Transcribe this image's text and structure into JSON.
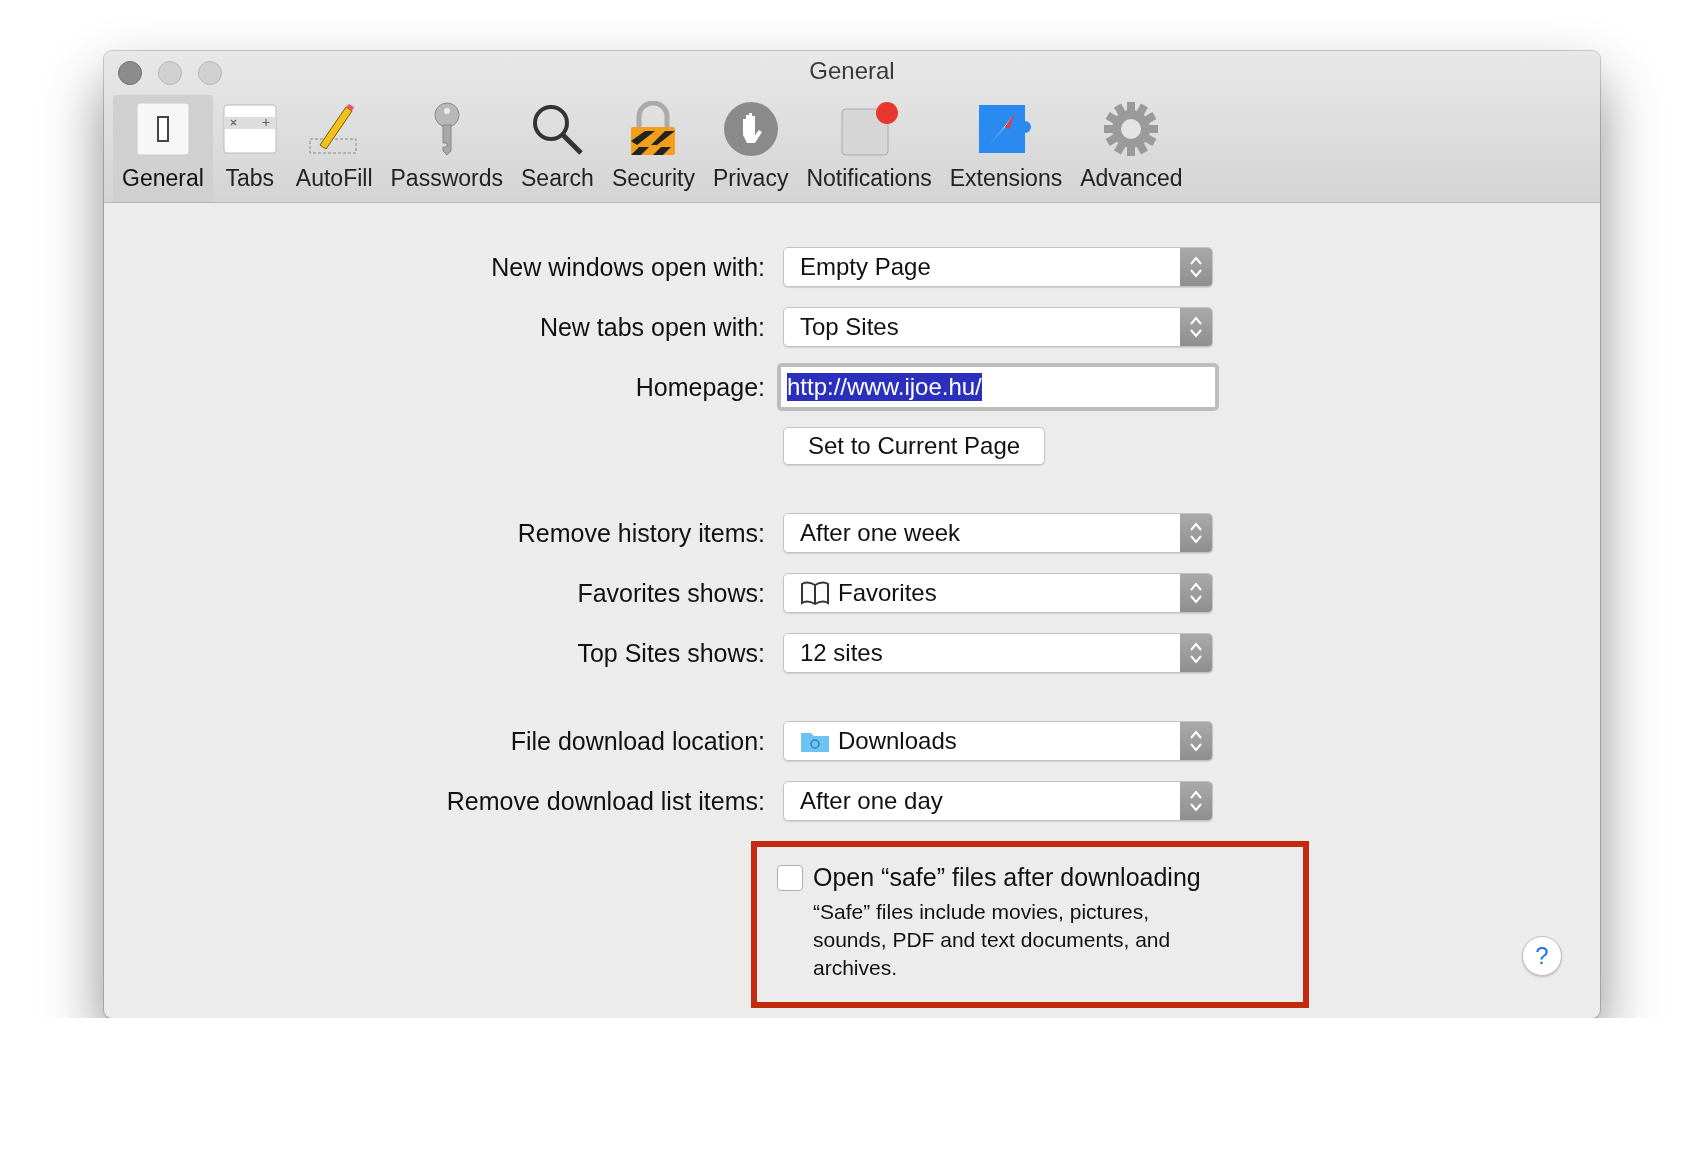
{
  "window": {
    "title": "General"
  },
  "toolbar": [
    {
      "label": "General",
      "selected": true
    },
    {
      "label": "Tabs",
      "selected": false
    },
    {
      "label": "AutoFill",
      "selected": false
    },
    {
      "label": "Passwords",
      "selected": false
    },
    {
      "label": "Search",
      "selected": false
    },
    {
      "label": "Security",
      "selected": false
    },
    {
      "label": "Privacy",
      "selected": false
    },
    {
      "label": "Notifications",
      "selected": false
    },
    {
      "label": "Extensions",
      "selected": false
    },
    {
      "label": "Advanced",
      "selected": false
    }
  ],
  "sections": [
    {
      "rows": [
        {
          "kind": "popup",
          "label": "New windows open with:",
          "value": "Empty Page"
        },
        {
          "kind": "popup",
          "label": "New tabs open with:",
          "value": "Top Sites"
        },
        {
          "kind": "field",
          "label": "Homepage:",
          "value": "http://www.ijoe.hu/",
          "text_selected": true
        },
        {
          "kind": "button",
          "value": "Set to Current Page"
        }
      ]
    },
    {
      "rows": [
        {
          "kind": "popup",
          "label": "Remove history items:",
          "value": "After one week"
        },
        {
          "kind": "bookmarks",
          "label": "Favorites shows:",
          "value": "Favorites"
        },
        {
          "kind": "popup",
          "label": "Top Sites shows:",
          "value": "12 sites"
        }
      ]
    },
    {
      "rows": [
        {
          "kind": "folder",
          "label": "File download location:",
          "value": "Downloads"
        },
        {
          "kind": "popup",
          "label": "Remove download list items:",
          "value": "After one day"
        }
      ]
    }
  ],
  "safe_files": {
    "highlighted": true,
    "checked": false,
    "label": "Open “safe” files after downloading",
    "note": "“Safe” files include movies, pictures, sounds, PDF and text documents, and archives."
  },
  "help": {
    "label": "?"
  }
}
